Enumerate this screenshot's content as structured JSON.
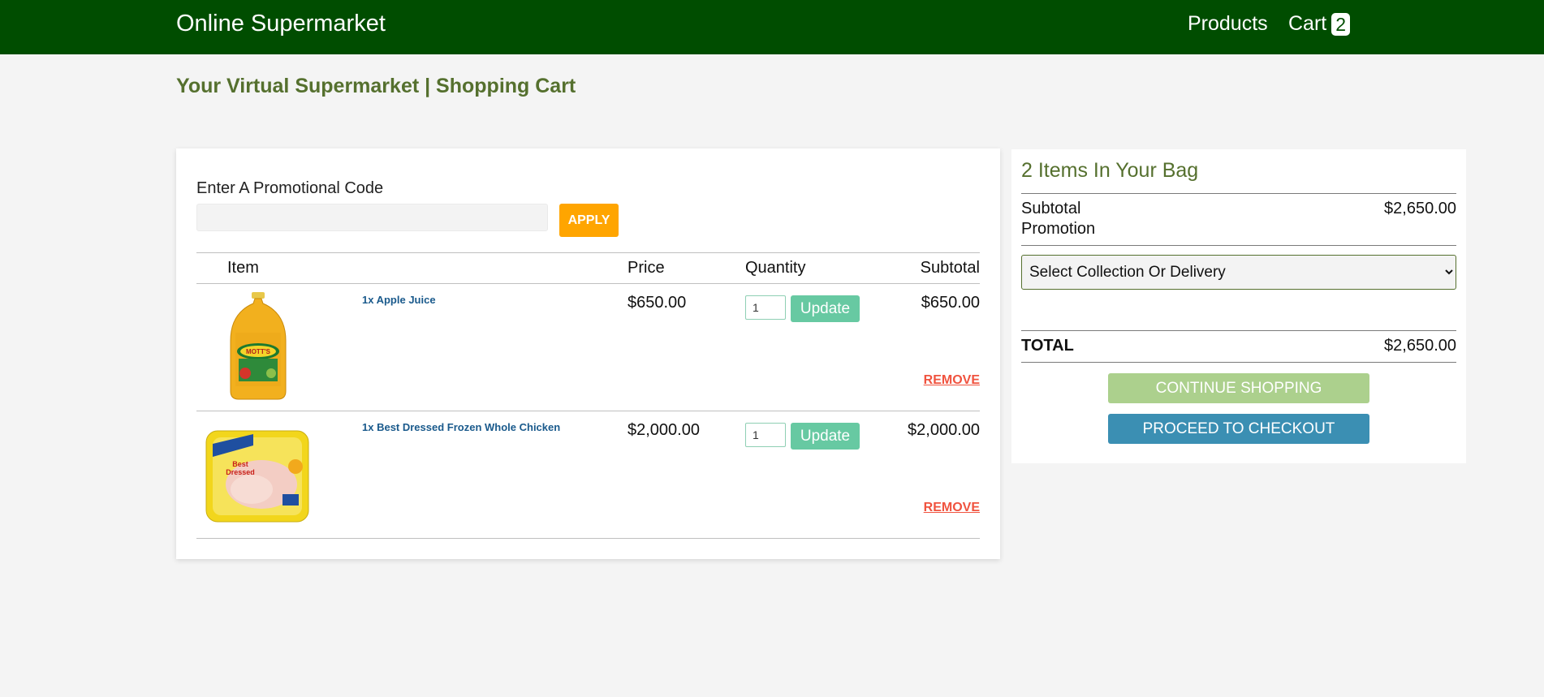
{
  "header": {
    "brand": "Online Supermarket",
    "nav": {
      "products": "Products",
      "cart": "Cart",
      "cart_count": "2"
    },
    "bg_color": "#004d00"
  },
  "page_title": "Your Virtual Supermarket | Shopping Cart",
  "promo": {
    "label": "Enter A Promotional Code",
    "value": "",
    "placeholder": "",
    "apply_label": "APPLY"
  },
  "table": {
    "headers": {
      "item": "Item",
      "price": "Price",
      "quantity": "Quantity",
      "subtotal": "Subtotal"
    },
    "rows": [
      {
        "name": "1x Apple Juice",
        "price": "$650.00",
        "quantity": "1",
        "update_label": "Update",
        "subtotal": "$650.00",
        "remove_label": "REMOVE",
        "image_icon": "apple-juice-bottle-icon"
      },
      {
        "name": "1x Best Dressed Frozen Whole Chicken",
        "price": "$2,000.00",
        "quantity": "1",
        "update_label": "Update",
        "subtotal": "$2,000.00",
        "remove_label": "REMOVE",
        "image_icon": "frozen-chicken-package-icon"
      }
    ]
  },
  "summary": {
    "title": "2 Items In Your Bag",
    "subtotal_label": "Subtotal",
    "subtotal_value": "$2,650.00",
    "promotion_label": "Promotion",
    "select_value": "Select Collection Or Delivery",
    "total_label": "TOTAL",
    "total_value": "$2,650.00",
    "continue_label": "CONTINUE SHOPPING",
    "checkout_label": "PROCEED TO CHECKOUT"
  },
  "colors": {
    "title_green": "#55702e",
    "apply_orange": "#ffa500",
    "update_green": "#67c9a2",
    "remove_red": "#f0533f",
    "continue_green": "#acd08d",
    "checkout_blue": "#3b8fb3"
  }
}
